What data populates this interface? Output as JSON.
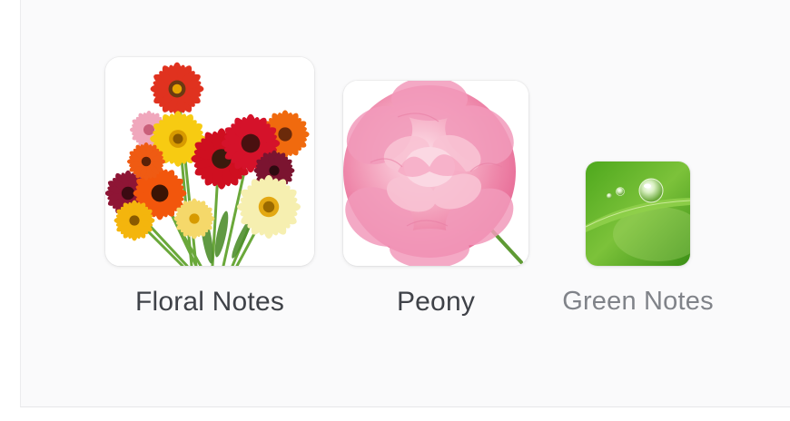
{
  "carousel": {
    "items": [
      {
        "label": "Floral Notes",
        "image": "gerbera-bouquet-image",
        "state": "normal"
      },
      {
        "label": "Peony",
        "image": "pink-peony-image",
        "state": "normal"
      },
      {
        "label": "Green Notes",
        "image": "green-leaf-waterdrop-image",
        "state": "faded"
      }
    ]
  },
  "colors": {
    "label_text": "#3f4248",
    "label_text_faded": "#808389",
    "panel_background": "#fafafb"
  }
}
